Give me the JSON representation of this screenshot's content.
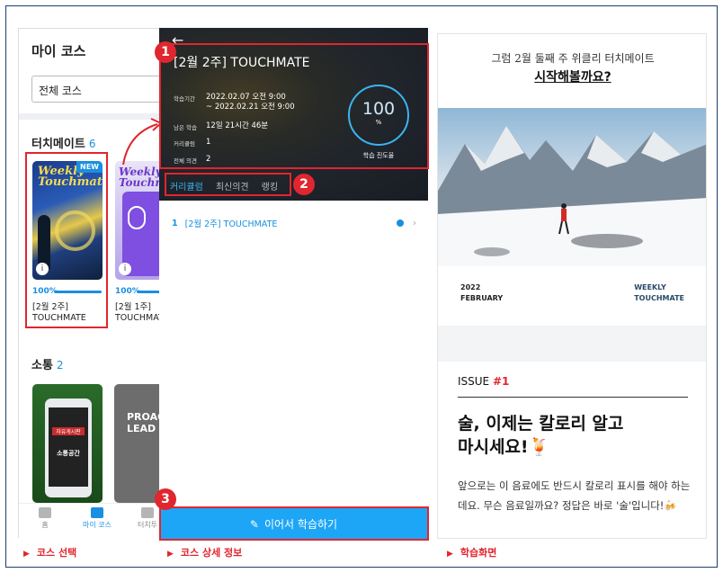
{
  "panel1": {
    "title": "마이 코스",
    "filter": "전체 코스",
    "section1": {
      "label": "터치메이트",
      "count": "6"
    },
    "courses": [
      {
        "cover_title": "Weekly Touchmate",
        "badge": "NEW",
        "progress_label": "100%",
        "progress": 1.0,
        "name_line1": "[2월 2주]",
        "name_line2": "TOUCHMATE"
      },
      {
        "cover_title": "Weekly Touchmate",
        "progress_label": "100%",
        "progress": 1.0,
        "name_line1": "[2월 1주]",
        "name_line2": "TOUCHMATE"
      }
    ],
    "section2": {
      "label": "소통",
      "count": "2"
    },
    "cover3_text1": "자유게시판",
    "cover3_text2": "소통공간",
    "cover4_text": "PROACT LEAD",
    "nav": [
      {
        "label": "홈",
        "icon": "home-icon"
      },
      {
        "label": "마이 코스",
        "icon": "book-icon"
      },
      {
        "label": "터치투",
        "icon": "chat-icon"
      }
    ]
  },
  "panel2": {
    "back_icon": "back-arrow-icon",
    "title": "[2월 2주] TOUCHMATE",
    "info": [
      {
        "key": "학습기간",
        "value": "2022.02.07 오전 9:00",
        "value2": "~ 2022.02.21 오전 9:00"
      },
      {
        "key": "남은 학습",
        "value": "12일 21시간 46분"
      },
      {
        "key": "커리큘럼",
        "value": "1"
      },
      {
        "key": "전체 의견",
        "value": "2"
      }
    ],
    "progress_value": "100",
    "progress_unit": "%",
    "progress_label": "학습 진도율",
    "tabs": [
      "커리큘럼",
      "최신의견",
      "랭킹"
    ],
    "curriculum_row": {
      "index": "1",
      "title": "[2월 2주] TOUCHMATE"
    },
    "cta": "이어서 학습하기"
  },
  "panel3": {
    "intro1": "그럼 2월 둘째 주 위클리 터치메이트",
    "intro2": "시작해볼까요?",
    "footer_left1": "2022",
    "footer_left2": "FEBRUARY",
    "footer_right1": "WEEKLY",
    "footer_right2": "TOUCHMATE",
    "issue_label": "ISSUE",
    "issue_num": "#1",
    "headline1": "술, 이제는 칼로리 알고",
    "headline2": "마시세요!🍹",
    "body": "앞으로는 이 음료에도 반드시 칼로리 표시를 해야 하는데요. 무슨 음료일까요? 정답은 바로 '술'입니다!🍻"
  },
  "markers": [
    "1",
    "2",
    "3"
  ],
  "captions": [
    "코스 선택",
    "코스 상세 정보",
    "학습화면"
  ],
  "colors": {
    "accent": "#1a8fe0",
    "cta": "#1ea6f6",
    "highlight": "#e0262e"
  }
}
